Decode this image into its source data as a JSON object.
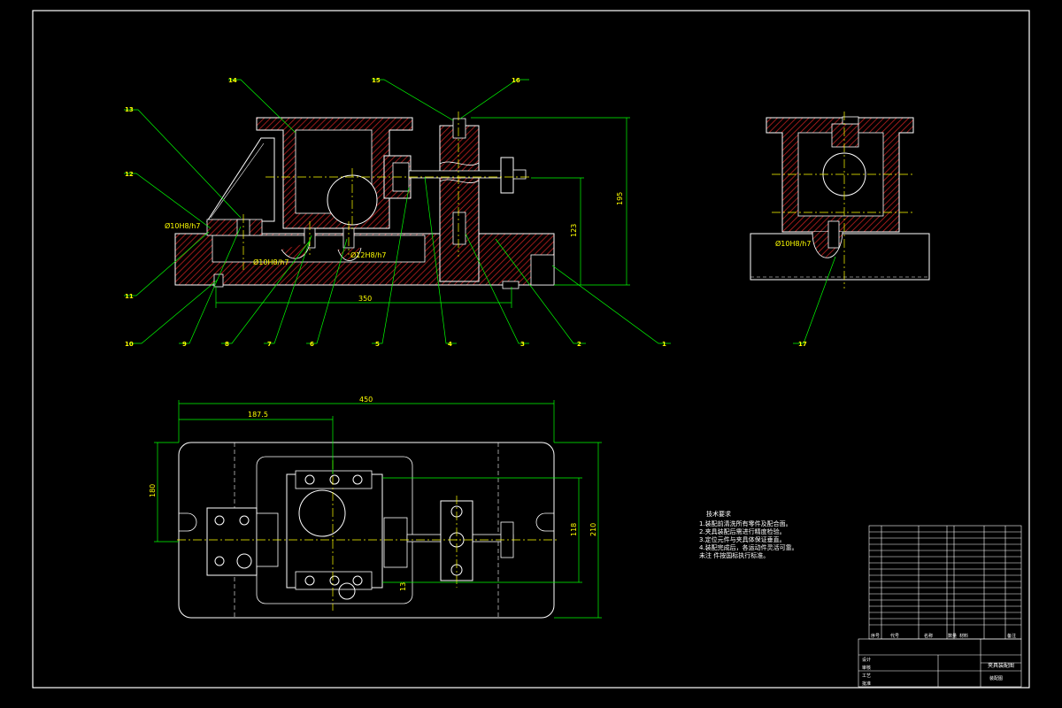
{
  "colors": {
    "background": "#000000",
    "frame": "#ffffff",
    "outline": "#ffffff",
    "hatch": "#c02020",
    "leader": "#00ff00",
    "dimension": "#00ff00",
    "centerline": "#ffff00",
    "label": "#ffff00",
    "table_line": "#ffffff"
  },
  "balloons": [
    {
      "id": "b1",
      "text": "1"
    },
    {
      "id": "b2",
      "text": "2"
    },
    {
      "id": "b3",
      "text": "3"
    },
    {
      "id": "b4",
      "text": "4"
    },
    {
      "id": "b5",
      "text": "5"
    },
    {
      "id": "b6",
      "text": "6"
    },
    {
      "id": "b7",
      "text": "7"
    },
    {
      "id": "b8",
      "text": "8"
    },
    {
      "id": "b9",
      "text": "9"
    },
    {
      "id": "b10",
      "text": "10"
    },
    {
      "id": "b11",
      "text": "11"
    },
    {
      "id": "b12",
      "text": "12"
    },
    {
      "id": "b13",
      "text": "13"
    },
    {
      "id": "b14",
      "text": "14"
    },
    {
      "id": "b15",
      "text": "15"
    },
    {
      "id": "b16",
      "text": "16"
    },
    {
      "id": "b17",
      "text": "17"
    }
  ],
  "fits": {
    "front_left_pin": "Ø10H8/h7",
    "front_base_pin": "Ø10H8/h7",
    "front_support_pin": "Ø12H8/h7",
    "side_pin": "Ø10H8/h7"
  },
  "dimensions": {
    "front_length": "350",
    "front_height_total": "195",
    "front_height_axis": "123",
    "top_length": "450",
    "top_offset": "187.5",
    "top_width": "210",
    "top_slot_spacing": "180",
    "top_inner_width": "118",
    "top_small": "13"
  },
  "tech_requirements": {
    "title": "技术要求",
    "items": [
      "1.装配前清洗所有零件及配合面。",
      "2.夹具装配后需进行精度检验。",
      "3.定位元件与夹具体保证垂直。",
      "4.装配完成后，各运动件灵活可靠。",
      "未注 件按国标执行标准。"
    ]
  },
  "title_block": {
    "header": [
      "序号",
      "代号",
      "名称",
      "数量",
      "材料",
      "备注"
    ],
    "drawing_name": "夹具装配图",
    "sub_name": "装配图",
    "footer_labels": [
      "设计",
      "审核",
      "工艺",
      "批准"
    ]
  }
}
